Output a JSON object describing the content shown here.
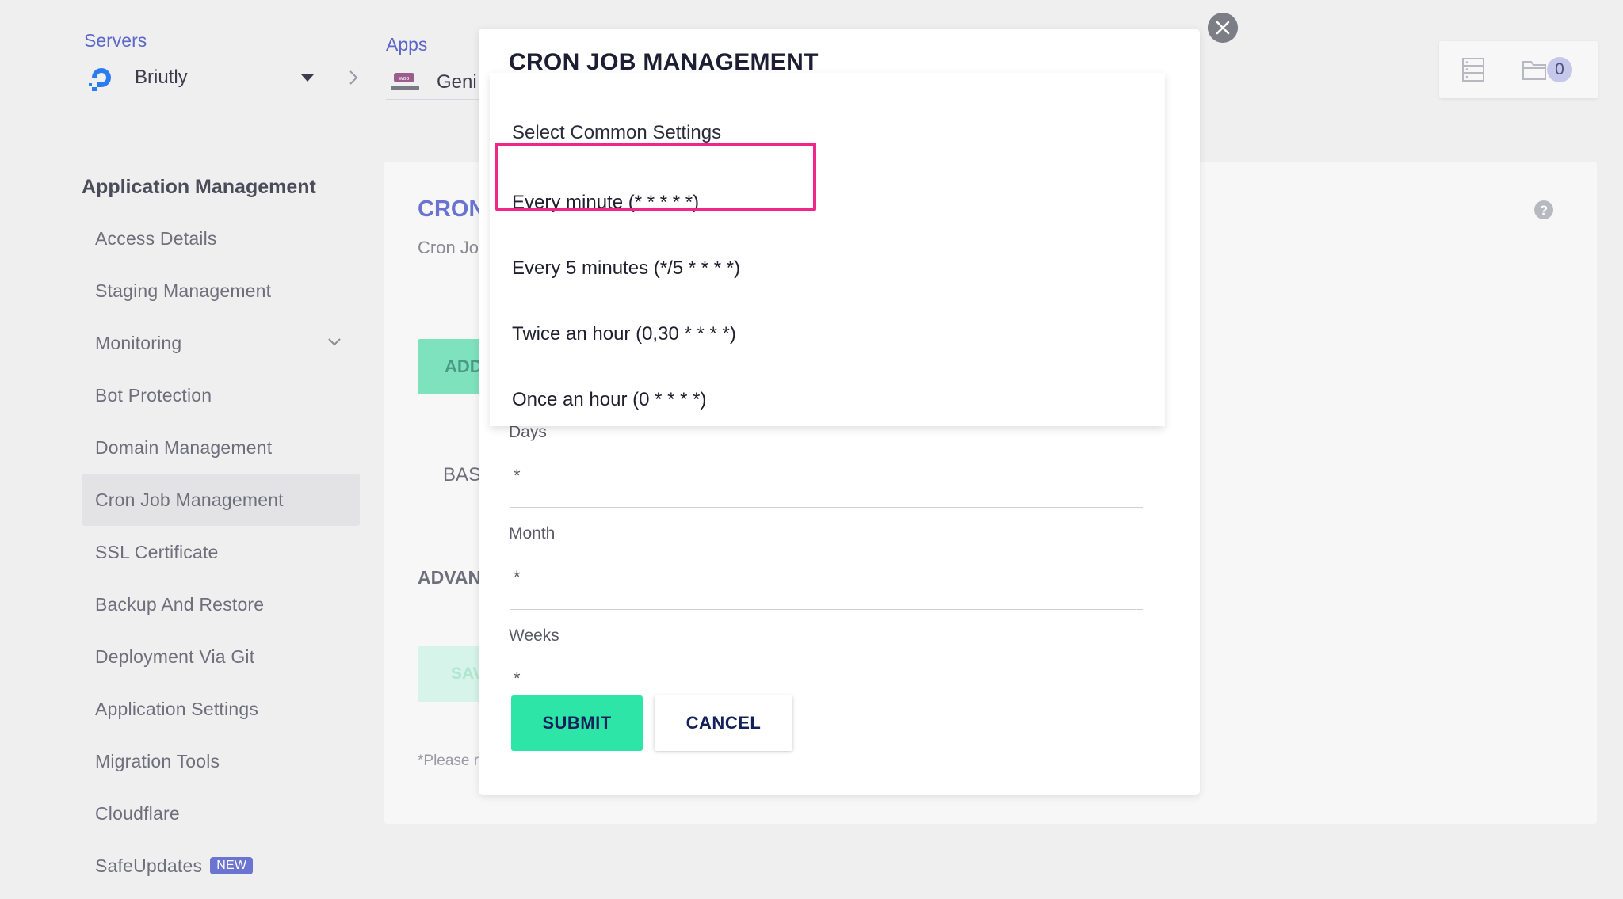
{
  "header": {
    "servers_label": "Servers",
    "server_name": "Briutly",
    "apps_label": "Apps",
    "app_name": "Geni",
    "folder_count": "0"
  },
  "sidebar": {
    "heading": "Application Management",
    "items": [
      {
        "label": "Access Details"
      },
      {
        "label": "Staging Management"
      },
      {
        "label": "Monitoring"
      },
      {
        "label": "Bot Protection"
      },
      {
        "label": "Domain Management"
      },
      {
        "label": "Cron Job Management",
        "active": true
      },
      {
        "label": "SSL Certificate"
      },
      {
        "label": "Backup And Restore"
      },
      {
        "label": "Deployment Via Git"
      },
      {
        "label": "Application Settings"
      },
      {
        "label": "Migration Tools"
      },
      {
        "label": "Cloudflare"
      },
      {
        "label": "SafeUpdates",
        "badge": "NEW"
      }
    ]
  },
  "content": {
    "title": "CRON",
    "subtitle": "Cron Jo",
    "add_button": "ADD",
    "tab_basic": "BAS",
    "advanced_label": "ADVAN",
    "save_button": "SAV",
    "note": "*Please r"
  },
  "modal": {
    "title": "CRON JOB MANAGEMENT",
    "dropdown": {
      "header": "Select Common Settings",
      "options": [
        "Every minute (* * * * *)",
        "Every 5 minutes (*/5 * * * *)",
        "Twice an hour (0,30 * * * *)",
        "Once an hour (0 * * * *)"
      ],
      "highlighted_index": 0
    },
    "fields": {
      "days": {
        "label": "Days",
        "value": "*"
      },
      "month": {
        "label": "Month",
        "value": "*"
      },
      "weeks": {
        "label": "Weeks",
        "value": "*"
      }
    },
    "submit_label": "SUBMIT",
    "cancel_label": "CANCEL"
  },
  "colors": {
    "accent": "#5c67c7",
    "submit": "#2ee5a8",
    "highlight": "#f0268a",
    "badge": "#6c74d1"
  }
}
